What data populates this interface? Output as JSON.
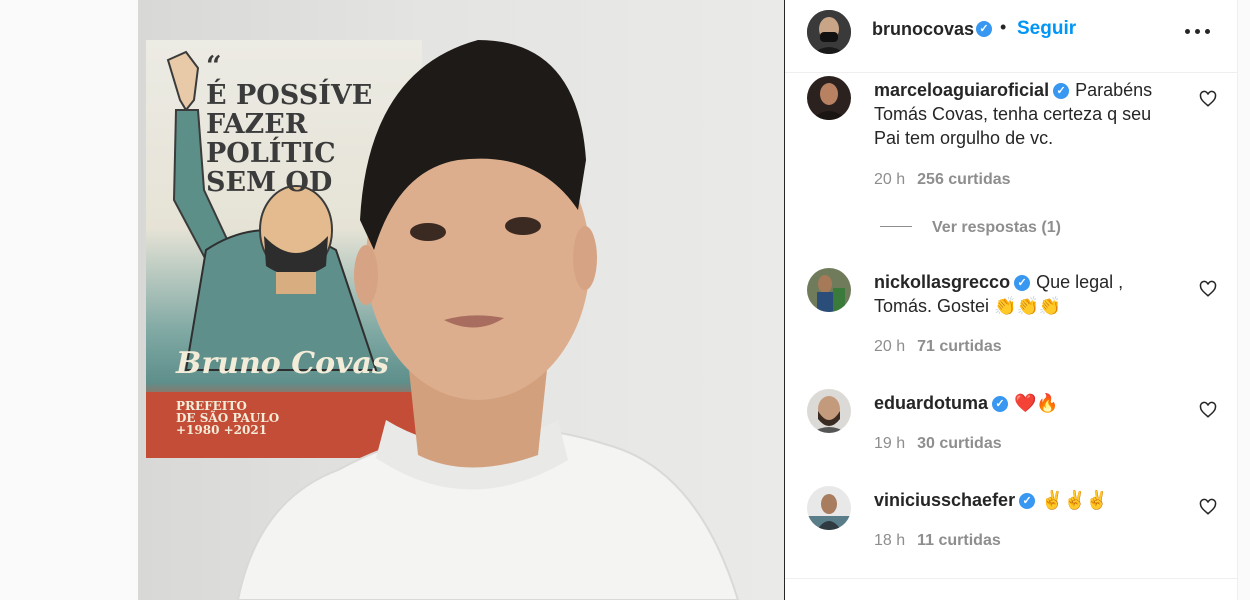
{
  "post": {
    "username": "brunocovas",
    "follow_label": "Seguir",
    "separator": "•"
  },
  "poster": {
    "quote": "“\nÉ POSSÍVE\nFAZER\nPOLÍTIC\nSEM OD",
    "name": "Bruno Covas",
    "caption": "PREFEITO\nDE SÃO PAULO\n+1980 +2021"
  },
  "comments": [
    {
      "username": "marceloaguiaroficial",
      "verified": true,
      "text": "Parabéns Tomás Covas, tenha certeza q seu Pai tem orgulho de vc.",
      "time": "20 h",
      "likes": "256 curtidas",
      "replies": "Ver respostas (1)"
    },
    {
      "username": "nickollasgrecco",
      "verified": true,
      "text": "Que legal , Tomás. Gostei 👏👏👏",
      "time": "20 h",
      "likes": "71 curtidas"
    },
    {
      "username": "eduardotuma",
      "verified": true,
      "text": "❤️🔥",
      "time": "19 h",
      "likes": "30 curtidas"
    },
    {
      "username": "viniciusschaefer",
      "verified": true,
      "text": "✌️✌️✌️",
      "time": "18 h",
      "likes": "11 curtidas"
    }
  ],
  "icons": {
    "verified": "verified-badge-icon",
    "like": "heart-outline-icon",
    "more": "more-horizontal-icon"
  },
  "colors": {
    "link_blue": "#0095f6",
    "verified_blue": "#3897f0",
    "meta_gray": "#8e8e8e",
    "text": "#262626"
  }
}
